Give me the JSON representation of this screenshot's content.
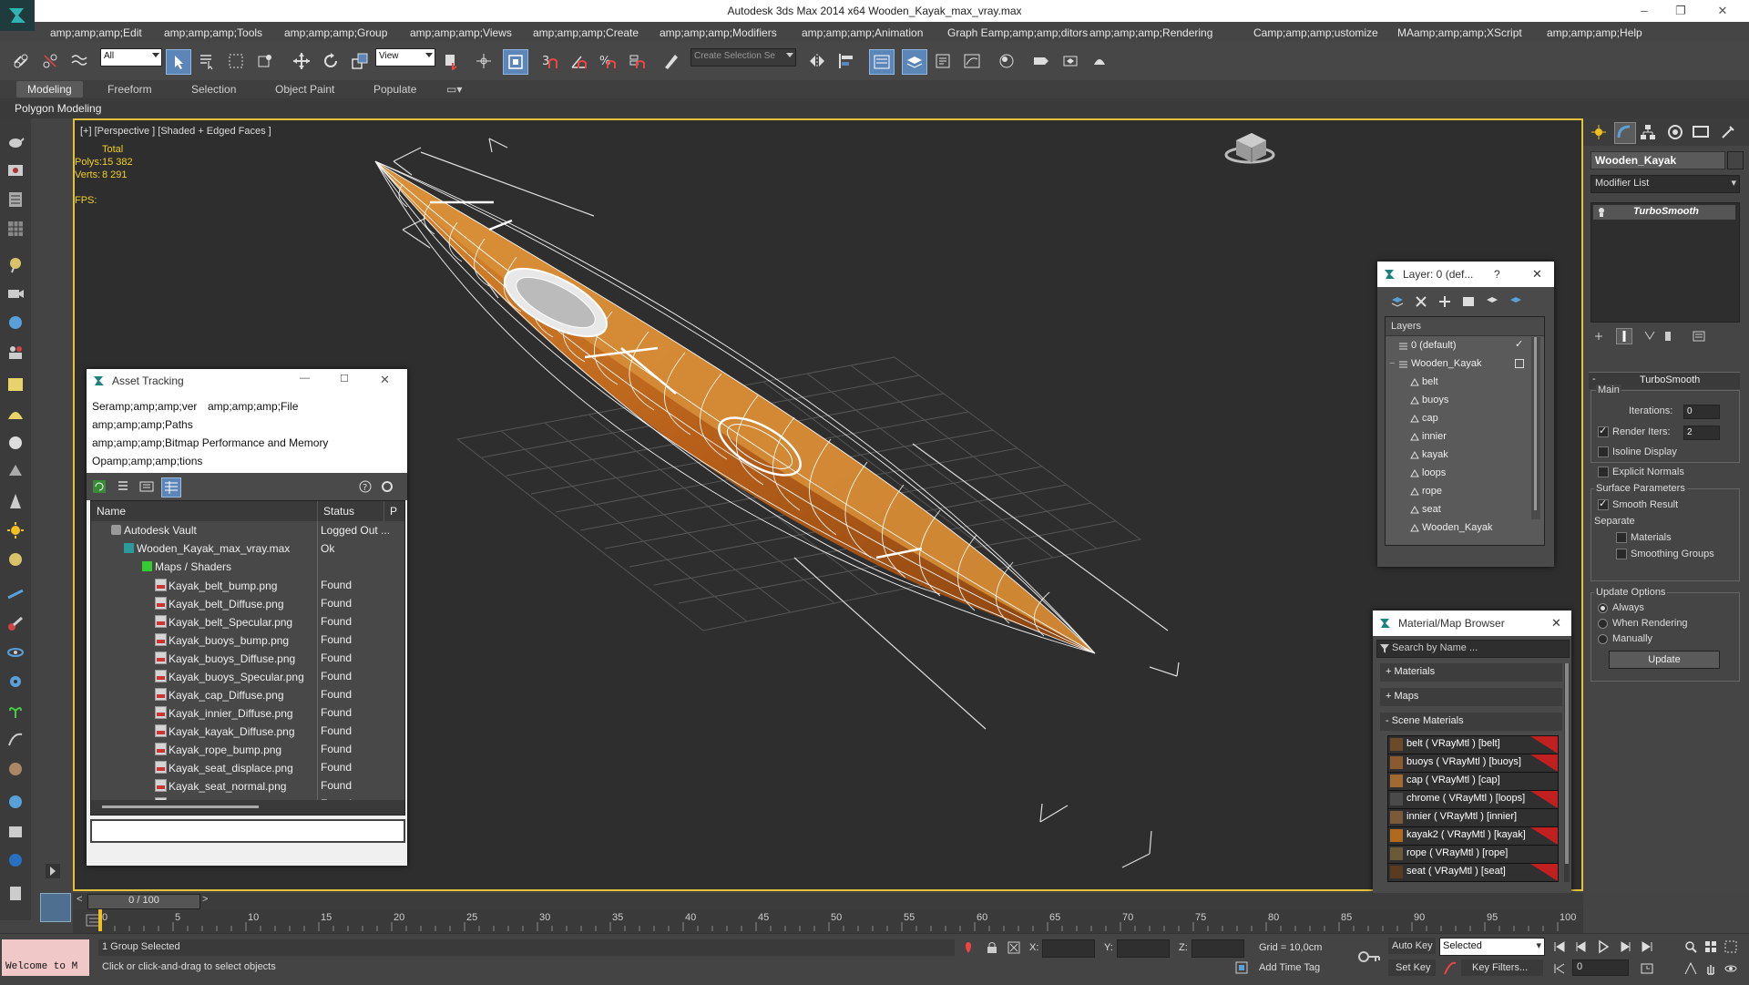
{
  "window": {
    "title": "Autodesk 3ds Max  2014 x64     Wooden_Kayak_max_vray.max"
  },
  "menu": [
    "amp;amp;amp;Edit",
    "amp;amp;amp;Tools",
    "amp;amp;amp;Group",
    "amp;amp;amp;Views",
    "amp;amp;amp;Create",
    "amp;amp;amp;Modifiers",
    "amp;amp;amp;Animation",
    "Graph Eamp;amp;amp;ditors",
    "amp;amp;amp;Rendering",
    "Camp;amp;amp;ustomize",
    "MAamp;amp;amp;XScript",
    "amp;amp;amp;Help"
  ],
  "toolbar": {
    "filter_value": "All",
    "refcoord_value": "View",
    "selection_set_placeholder": "Create Selection Se"
  },
  "ribbon": {
    "tabs": [
      "Modeling",
      "Freeform",
      "Selection",
      "Object Paint",
      "Populate"
    ],
    "sub": "Polygon Modeling"
  },
  "viewport": {
    "label": "[+] [Perspective ] [Shaded + Edged Faces ]",
    "stats": {
      "total_label": "Total",
      "polys_label": "Polys:",
      "polys_value": "15 382",
      "verts_label": "Verts:",
      "verts_value": "8 291",
      "fps_label": "FPS:"
    }
  },
  "asset_tracking": {
    "title": "Asset Tracking",
    "menu": [
      "Seramp;amp;amp;ver",
      "amp;amp;amp;File",
      "amp;amp;amp;Paths",
      "amp;amp;amp;Bitmap Performance and Memory",
      "Opamp;amp;amp;tions"
    ],
    "columns": [
      "Name",
      "Status",
      "P"
    ],
    "rows": [
      {
        "name": "Autodesk Vault",
        "status": "Logged Out ..."
      },
      {
        "name": "Wooden_Kayak_max_vray.max",
        "status": "Ok"
      },
      {
        "name": "Maps / Shaders",
        "status": ""
      },
      {
        "name": "Kayak_belt_bump.png",
        "status": "Found"
      },
      {
        "name": "Kayak_belt_Diffuse.png",
        "status": "Found"
      },
      {
        "name": "Kayak_belt_Specular.png",
        "status": "Found"
      },
      {
        "name": "Kayak_buoys_bump.png",
        "status": "Found"
      },
      {
        "name": "Kayak_buoys_Diffuse.png",
        "status": "Found"
      },
      {
        "name": "Kayak_buoys_Specular.png",
        "status": "Found"
      },
      {
        "name": "Kayak_cap_Diffuse.png",
        "status": "Found"
      },
      {
        "name": "Kayak_innier_Diffuse.png",
        "status": "Found"
      },
      {
        "name": "Kayak_kayak_Diffuse.png",
        "status": "Found"
      },
      {
        "name": "Kayak_rope_bump.png",
        "status": "Found"
      },
      {
        "name": "Kayak_seat_displace.png",
        "status": "Found"
      },
      {
        "name": "Kayak_seat_normal.png",
        "status": "Found"
      },
      {
        "name": "Kayak_seat_Specular.png",
        "status": "Found"
      }
    ]
  },
  "layers": {
    "title": "Layer: 0 (def...",
    "help": "?",
    "header": "Layers",
    "items": [
      "0 (default)",
      "Wooden_Kayak",
      "belt",
      "buoys",
      "cap",
      "innier",
      "kayak",
      "loops",
      "rope",
      "seat",
      "Wooden_Kayak"
    ]
  },
  "material_browser": {
    "title": "Material/Map Browser",
    "search_placeholder": "Search by Name ...",
    "sections": [
      "+ Materials",
      "+ Maps",
      "- Scene Materials"
    ],
    "materials": [
      "belt  ( VRayMtl ) [belt]",
      "buoys  ( VRayMtl ) [buoys]",
      "cap  ( VRayMtl ) [cap]",
      "chrome  ( VRayMtl ) [loops]",
      "innier  ( VRayMtl ) [innier]",
      "kayak2  ( VRayMtl ) [kayak]",
      "rope  ( VRayMtl ) [rope]",
      "seat  ( VRayMtl ) [seat]"
    ]
  },
  "command_panel": {
    "object_name": "Wooden_Kayak",
    "modifier_list": "Modifier List",
    "stack_item": "TurboSmooth",
    "rollout_title": "TurboSmooth",
    "main_label": "Main",
    "iterations_label": "Iterations:",
    "iterations_value": "0",
    "render_iters_label": "Render Iters:",
    "render_iters_value": "2",
    "isoline": "Isoline Display",
    "explicit": "Explicit Normals",
    "surface_label": "Surface Parameters",
    "smooth_result": "Smooth Result",
    "separate_label": "Separate",
    "materials": "Materials",
    "smoothing_groups": "Smoothing Groups",
    "update_options": "Update Options",
    "always": "Always",
    "when_rendering": "When Rendering",
    "manually": "Manually",
    "update_button": "Update"
  },
  "timeline": {
    "counter": "0 / 100",
    "ticks": [
      "0",
      "5",
      "10",
      "15",
      "20",
      "25",
      "30",
      "35",
      "40",
      "45",
      "50",
      "55",
      "60",
      "65",
      "70",
      "75",
      "80",
      "85",
      "90",
      "95",
      "100"
    ]
  },
  "status": {
    "welcome": "Welcome to M",
    "selected": "1 Group Selected",
    "prompt": "Click or click-and-drag to select objects",
    "x_label": "X:",
    "y_label": "Y:",
    "z_label": "Z:",
    "grid": "Grid = 10,0cm",
    "add_time_tag": "Add Time Tag",
    "auto_key": "Auto Key",
    "set_key": "Set Key",
    "key_mode": "Selected",
    "key_filters": "Key Filters...",
    "frame": "0"
  },
  "colors": {
    "accent": "#5c86b8",
    "viewport_border": "#e2c23a",
    "wood": "#c8701e",
    "missing_red": "#c02020"
  }
}
